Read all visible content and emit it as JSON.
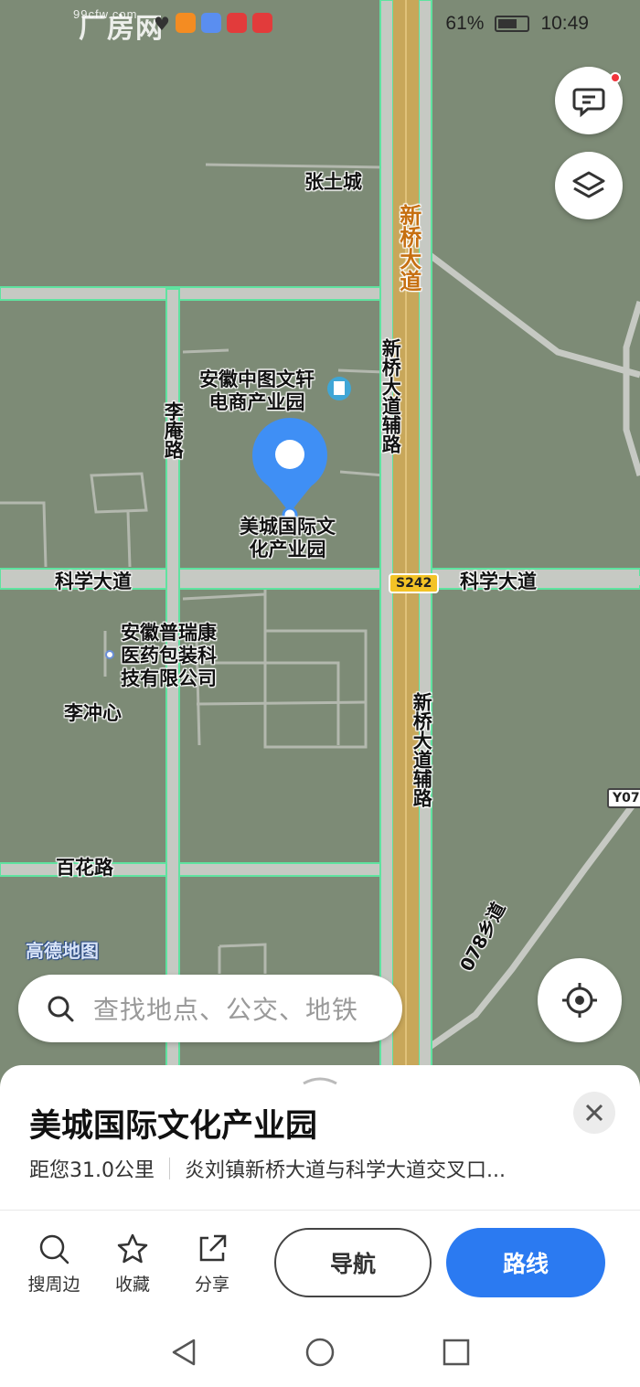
{
  "status_bar": {
    "watermark_brand": "厂房网",
    "watermark_url": "99cfw.com",
    "battery": "61%",
    "time": "10:49"
  },
  "map": {
    "labels": {
      "zhangtucheng": "张土城",
      "xinqiao_main": "新桥大道",
      "xinqiao_aux_top": "新桥大道辅路",
      "xinqiao_aux_bottom": "新桥大道辅路",
      "lian_road": "李庵路",
      "poi_zhongtu_line1": "安徽中图文轩",
      "poi_zhongtu_line2": "电商产业园",
      "poi_meicheng_line1": "美城国际文",
      "poi_meicheng_line2": "化产业园",
      "kexue_left": "科学大道",
      "kexue_right": "科学大道",
      "highway_shield": "S242",
      "poi_purui_line1": "安徽普瑞康",
      "poi_purui_line2": "医药包装科",
      "poi_purui_line3": "技有限公司",
      "lichongxin": "李冲心",
      "baihua_road": "百花路",
      "county_road": "078乡道",
      "shield_y07": "Y07",
      "map_logo": "高德地图"
    }
  },
  "search": {
    "placeholder": "查找地点、公交、地铁"
  },
  "sheet": {
    "title": "美城国际文化产业园",
    "distance": "距您31.0公里",
    "address": "炎刘镇新桥大道与科学大道交叉口...",
    "actions": {
      "nearby": "搜周边",
      "favorite": "收藏",
      "share": "分享"
    },
    "navigate_label": "导航",
    "route_label": "路线"
  },
  "colors": {
    "map_bg": "#7d8b76",
    "road": "#c6c9c3",
    "road_edge": "#5fe3a0",
    "main_road": "#c8a75a",
    "accent_blue": "#2b7af1",
    "pin_blue": "#3f8ff5"
  }
}
